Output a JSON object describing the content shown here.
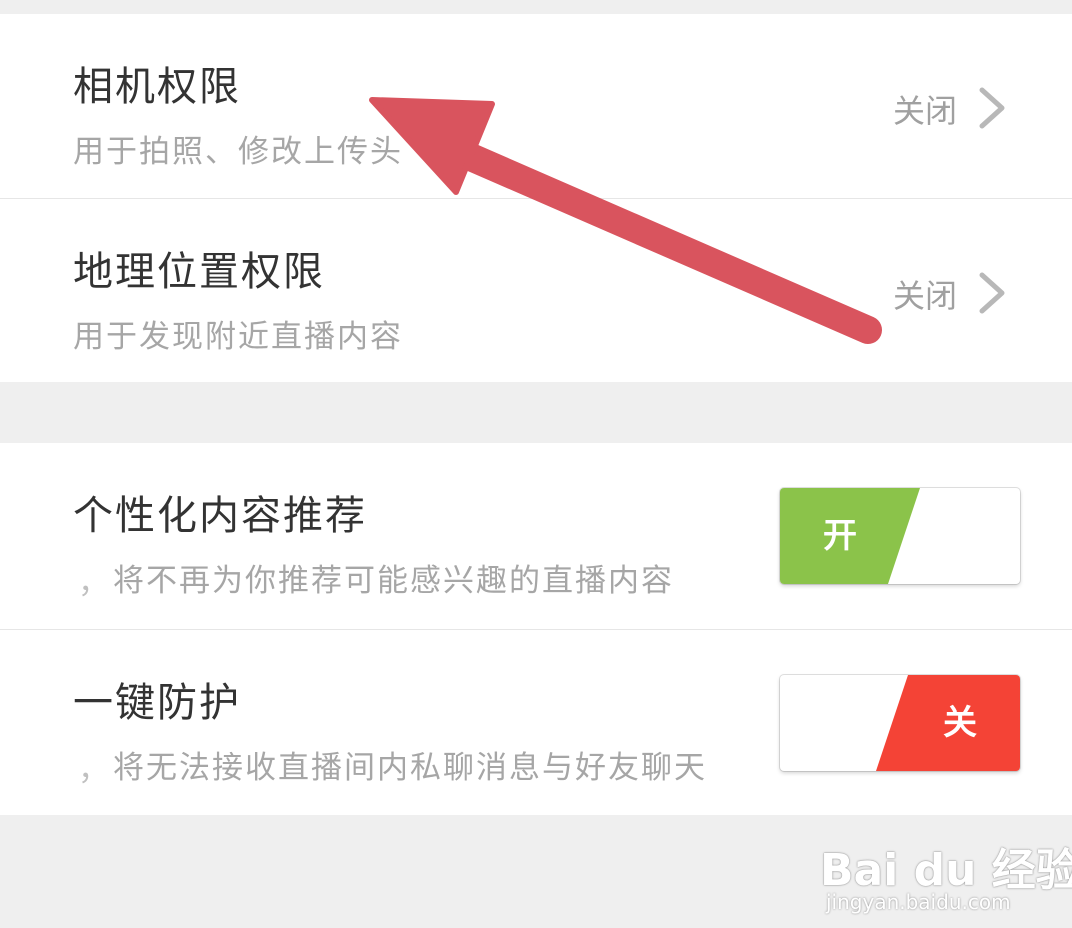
{
  "permissions": {
    "camera": {
      "title": "相机权限",
      "subtitle": "用于拍照、修改上传头",
      "status": "关闭"
    },
    "location": {
      "title": "地理位置权限",
      "subtitle": "用于发现附近直播内容",
      "status": "关闭"
    }
  },
  "privacy": {
    "recommend": {
      "title": "个性化内容推荐",
      "subtitle_prefix": "，",
      "subtitle": "将不再为你推荐可能感兴趣的直播内容",
      "toggle_label": "开",
      "toggle_state": "on",
      "toggle_color": "#8bc34a"
    },
    "protect": {
      "title": "一键防护",
      "subtitle_prefix": "，",
      "subtitle": "将无法接收直播间内私聊消息与好友聊天",
      "toggle_label": "关",
      "toggle_state": "off",
      "toggle_color": "#f44336"
    }
  },
  "annotation": {
    "arrow_color": "#d9545e"
  },
  "watermark": {
    "logo": "Bai du 经验",
    "url": "jingyan.baidu.com"
  }
}
